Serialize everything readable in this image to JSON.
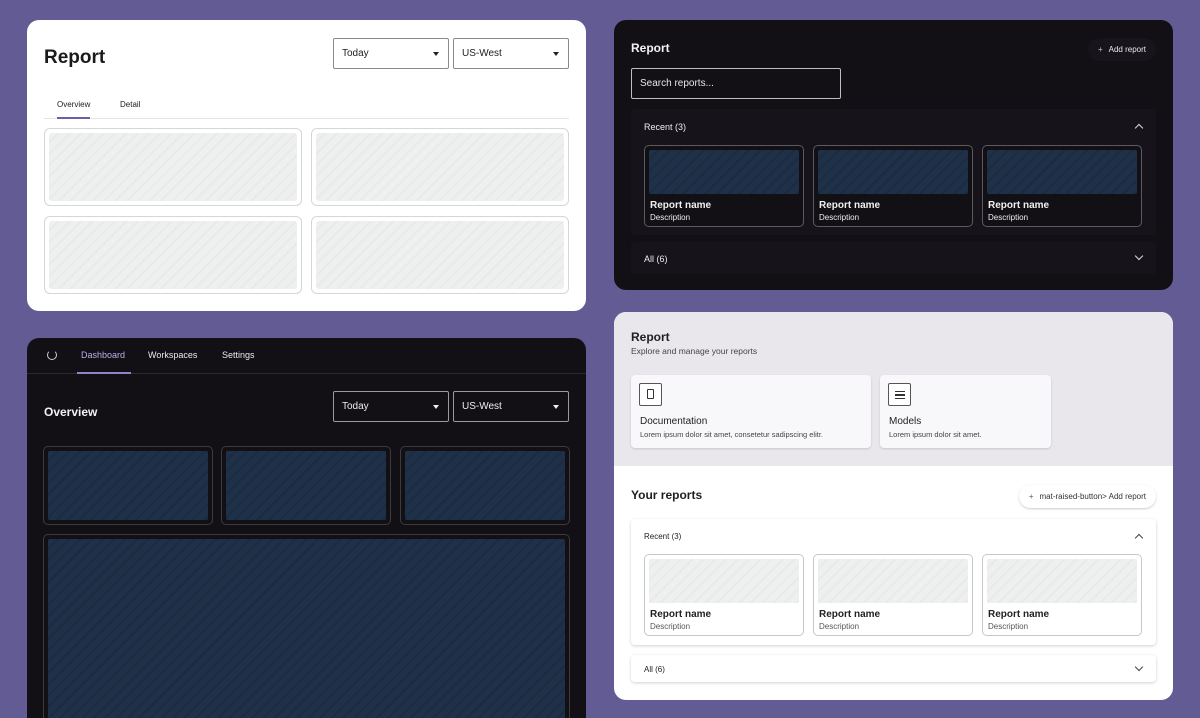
{
  "panel1": {
    "title": "Report",
    "select_date": "Today",
    "select_region": "US-West",
    "tabs": [
      "Overview",
      "Detail"
    ]
  },
  "panel2": {
    "title": "Report",
    "add_button": "Add report",
    "search_placeholder": "Search reports...",
    "recent_label": "Recent (3)",
    "all_label": "All (6)",
    "cards": [
      {
        "name": "Report name",
        "description": "Description"
      },
      {
        "name": "Report name",
        "description": "Description"
      },
      {
        "name": "Report name",
        "description": "Description"
      }
    ]
  },
  "panel3": {
    "nav": [
      "Dashboard",
      "Workspaces",
      "Settings"
    ],
    "title": "Overview",
    "select_date": "Today",
    "select_region": "US-West"
  },
  "panel4": {
    "title": "Report",
    "subtitle": "Explore and manage your reports",
    "doc_cards": [
      {
        "title": "Documentation",
        "description": "Lorem ipsum dolor sit amet, consetetur sadipscing elitr.",
        "icon": "document-icon"
      },
      {
        "title": "Models",
        "description": "Lorem ipsum dolor sit amet.",
        "icon": "list-icon"
      }
    ],
    "your_reports": "Your reports",
    "add_button": "mat-raised-button> Add report",
    "recent_label": "Recent (3)",
    "all_label": "All (6)",
    "cards": [
      {
        "name": "Report name",
        "description": "Description"
      },
      {
        "name": "Report name",
        "description": "Description"
      },
      {
        "name": "Report name",
        "description": "Description"
      }
    ]
  },
  "colors": {
    "background": "#635b93",
    "dark_panel": "#121015",
    "accent": "#8e84cf"
  }
}
